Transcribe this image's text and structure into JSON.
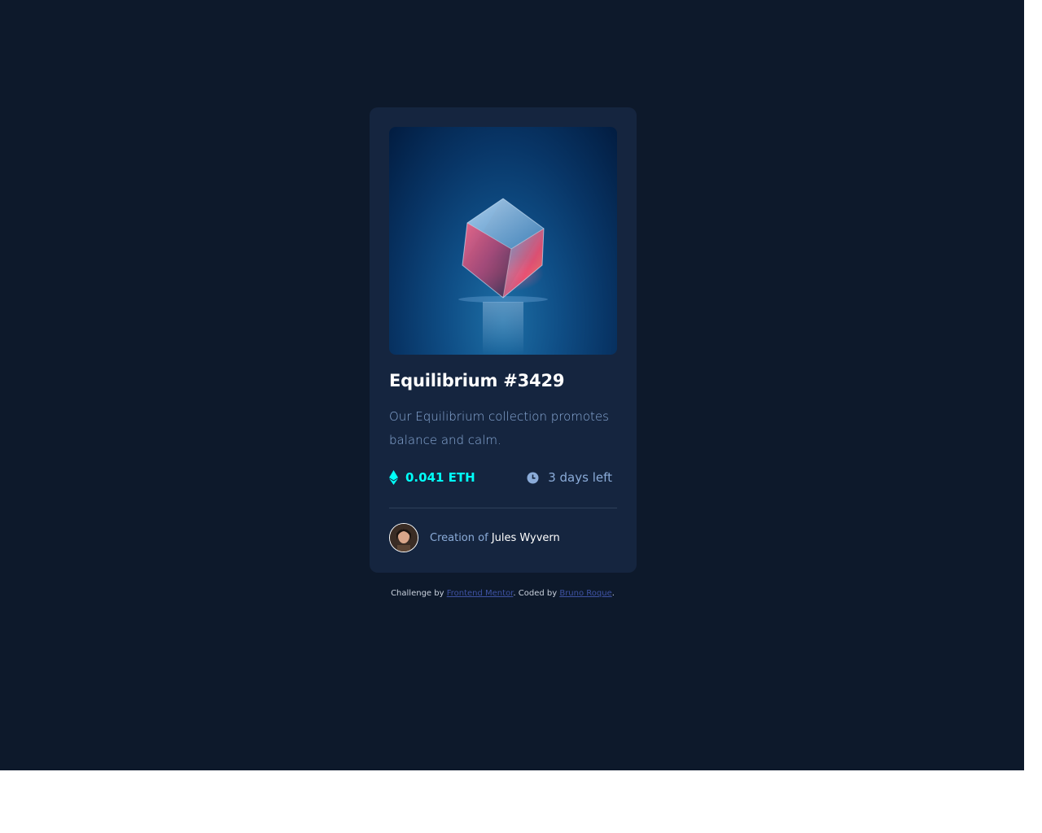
{
  "card": {
    "title": "Equilibrium #3429",
    "description": "Our Equilibrium collection promotes balance and calm.",
    "price": "0.041 ETH",
    "price_icon": "ethereum-icon",
    "time_left": "3 days left",
    "time_icon": "clock-icon",
    "creator_prefix": "Creation of",
    "creator_name": "Jules Wyvern",
    "hero_image": "cube-image",
    "avatar_image": "avatar"
  },
  "footer": {
    "challenge_prefix": "Challenge by",
    "challenge_link": "Frontend Mentor",
    "coded_prefix": ". Coded by",
    "coded_link": "Bruno Roque",
    "end": "."
  },
  "colors": {
    "page_bg": "#0d192b",
    "card_bg": "#15253f",
    "accent_cyan": "#00fff8",
    "muted_text": "#8bacd9",
    "link": "#3e52a3"
  }
}
